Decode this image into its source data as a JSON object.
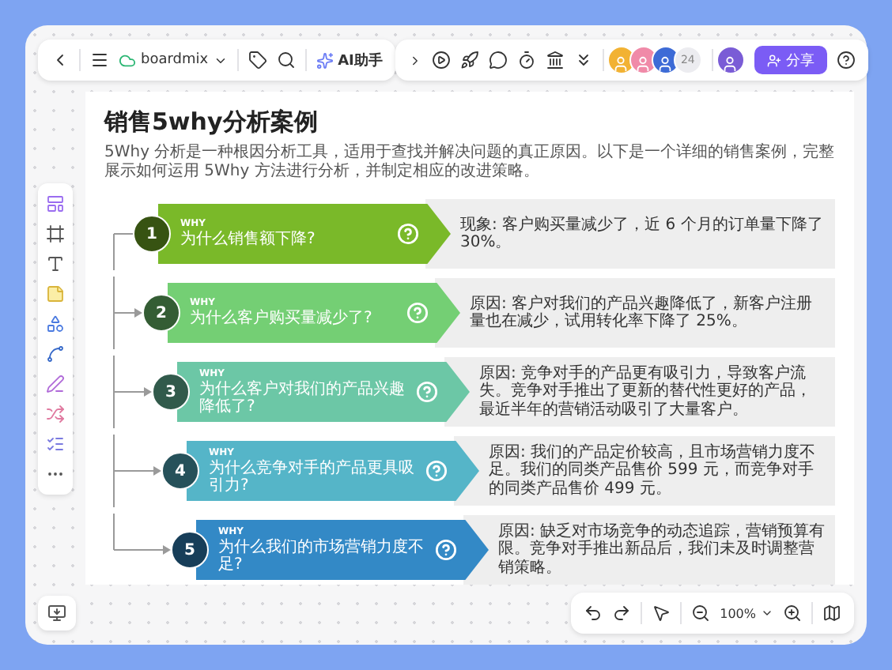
{
  "toolbar": {
    "file_name": "boardmix",
    "ai_label": "AI助手",
    "collaborator_count": "24",
    "share_label": "分享"
  },
  "zoom": "100%",
  "document": {
    "title": "销售5why分析案例",
    "subtitle": "5Why 分析是一种根因分析工具，适用于查找并解决问题的真正原因。以下是一个详细的销售案例，完整展示如何运用 5Why 方法进行分析，并制定相应的改进策略。",
    "steps": [
      {
        "number": "1",
        "tag": "WHY",
        "question": "为什么销售额下降?",
        "answer_label": "现象:",
        "answer": "客户购买量减少了，近 6 个月的订单量下降了 30%。",
        "color": "#7ab929"
      },
      {
        "number": "2",
        "tag": "WHY",
        "question": "为什么客户购买量减少了?",
        "answer_label": "原因:",
        "answer": "客户对我们的产品兴趣降低了，新客户注册量也在减少，试用转化率下降了 25%。",
        "color": "#74cf74"
      },
      {
        "number": "3",
        "tag": "WHY",
        "question": "为什么客户对我们的产品兴趣降低了?",
        "answer_label": "原因:",
        "answer": "竞争对手的产品更有吸引力，导致客户流失。竞争对手推出了更新的替代性更好的产品，最近半年的营销活动吸引了大量客户。",
        "color": "#6cc7a6"
      },
      {
        "number": "4",
        "tag": "WHY",
        "question": "为什么竞争对手的产品更具吸引力?",
        "answer_label": "原因:",
        "answer": "我们的产品定价较高，且市场营销力度不足。我们的同类产品售价 599 元，而竞争对手的同类产品售价 499 元。",
        "color": "#55b5c8"
      },
      {
        "number": "5",
        "tag": "WHY",
        "question": "为什么我们的市场营销力度不足?",
        "answer_label": "原因:",
        "answer": "缺乏对市场竞争的动态追踪，营销预算有限。竞争对手推出新品后，我们未及时调整营销策略。",
        "color": "#3389c6"
      }
    ]
  }
}
